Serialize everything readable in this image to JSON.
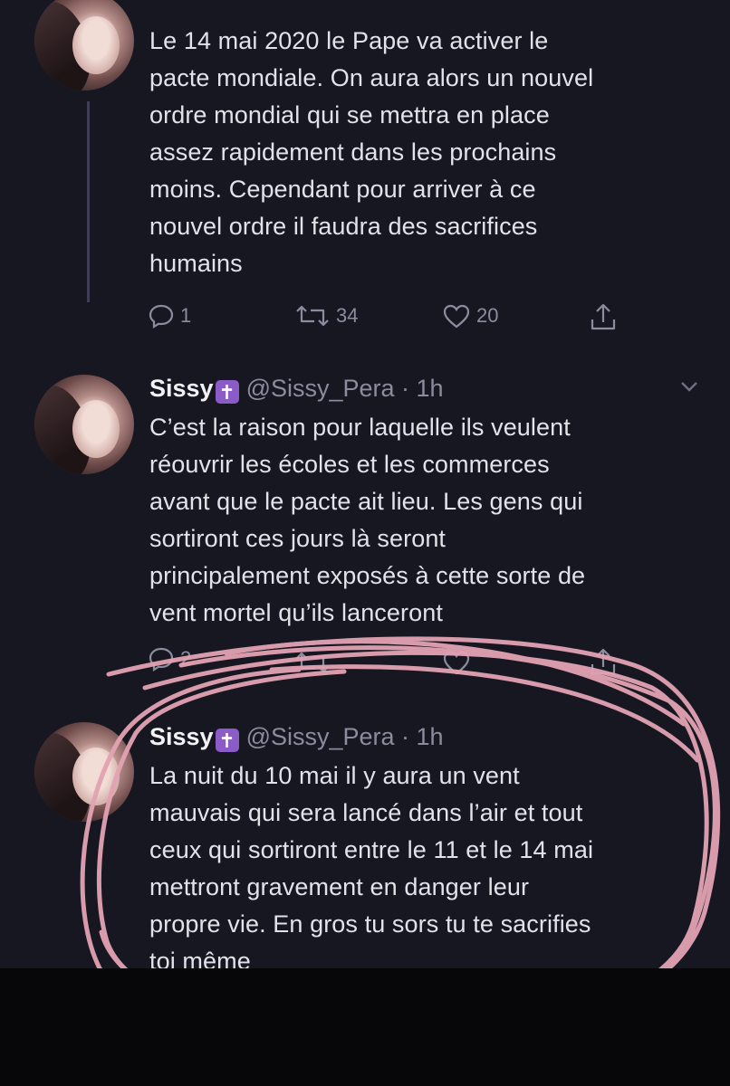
{
  "tweets": [
    {
      "text": "Le 14 mai 2020 le Pape va activer le\npacte mondiale. On aura alors un nouvel\nordre mondial qui se mettra en place\nassez rapidement dans les prochains\nmoins. Cependant pour arriver à ce\nnouvel ordre il faudra des sacrifices\nhumains",
      "actions": {
        "replies": "1",
        "retweets": "34",
        "likes": "20"
      }
    },
    {
      "name": "Sissy",
      "badge": "✝",
      "handle_time": "@Sissy_Pera · 1h",
      "text": "C’est la raison pour laquelle ils veulent\nréouvrir les écoles et les commerces\navant que le pacte ait lieu. Les gens qui\nsortiront ces jours là seront\nprincipalement exposés à cette sorte de\nvent mortel qu’ils lanceront",
      "actions": {
        "replies": "2"
      }
    },
    {
      "name": "Sissy",
      "badge": "✝",
      "handle_time": "@Sissy_Pera · 1h",
      "text": "La nuit du 10 mai il y aura un vent\nmauvais qui sera lancé dans l’air et tout\nceux qui sortiront entre le 11 et le 14 mai\nmettront gravement en danger leur\npropre vie. En gros tu sors tu te sacrifies\ntoi même"
    }
  ],
  "colors": {
    "background": "#171722",
    "text": "#e2e2e8",
    "secondary": "#8b8d9e",
    "badge": "#8b5cc7",
    "annotation": "#e3a3b3"
  }
}
